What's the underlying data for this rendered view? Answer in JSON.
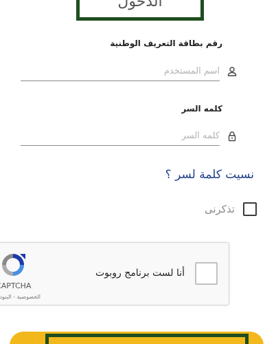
{
  "header": {
    "title": "الدخول"
  },
  "id_field": {
    "label": "رقم بطاقة التعريف الوطنية",
    "placeholder": "اسم المستخدم",
    "value": ""
  },
  "password_field": {
    "label": "كلمه السر",
    "placeholder": "كلمه السر",
    "value": ""
  },
  "forgot_password": {
    "label": "نسيت كلمة لسر ؟"
  },
  "remember_me": {
    "label": "تذكرنى",
    "checked": false
  },
  "recaptcha": {
    "label": "أنا لست برنامج روبوت",
    "brand": "reCAPTCHA",
    "terms": "الخصوصية - البنود"
  },
  "colors": {
    "accent_green": "#1f4d1f",
    "submit_yellow": "#f2b81b",
    "link_blue": "#1e3f8a"
  }
}
